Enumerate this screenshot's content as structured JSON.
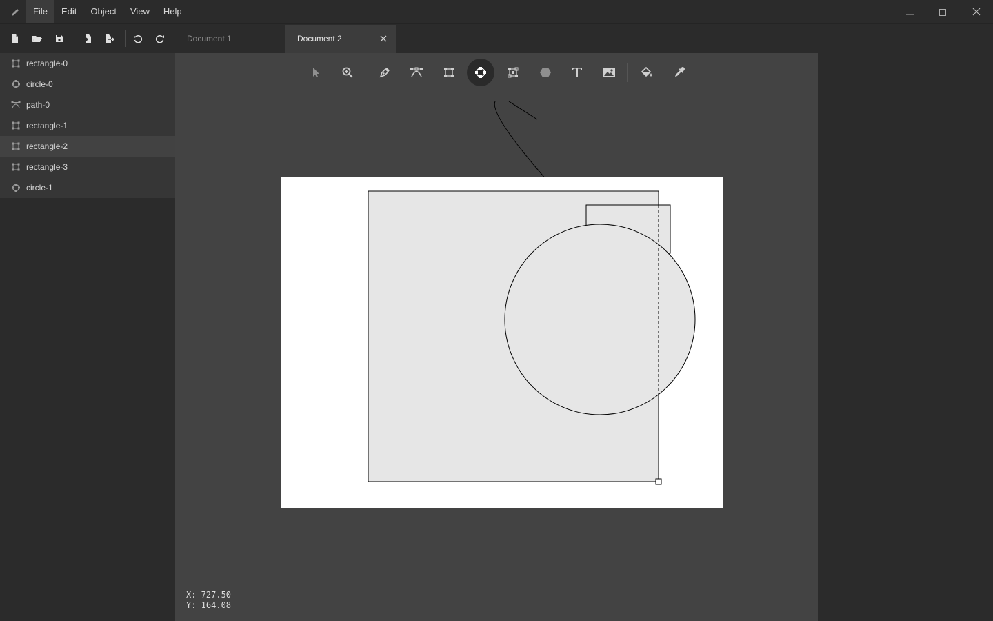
{
  "menu": {
    "items": [
      {
        "label": "File",
        "active": true
      },
      {
        "label": "Edit"
      },
      {
        "label": "Object"
      },
      {
        "label": "View"
      },
      {
        "label": "Help"
      }
    ]
  },
  "window_controls": [
    "minimize-icon",
    "restore-icon",
    "close-icon"
  ],
  "toolbar": {
    "buttons": [
      "new-file-icon",
      "open-folder-icon",
      "save-icon",
      "import-icon",
      "export-icon",
      "undo-icon",
      "redo-icon"
    ]
  },
  "tabs": [
    {
      "label": "Document 1",
      "active": false
    },
    {
      "label": "Document 2",
      "active": true
    }
  ],
  "layers": [
    {
      "label": "rectangle-0",
      "icon": "rectangle-icon"
    },
    {
      "label": "circle-0",
      "icon": "circle-icon"
    },
    {
      "label": "path-0",
      "icon": "path-icon"
    },
    {
      "label": "rectangle-1",
      "icon": "rectangle-icon"
    },
    {
      "label": "rectangle-2",
      "icon": "rectangle-icon",
      "selected": true
    },
    {
      "label": "rectangle-3",
      "icon": "rectangle-icon"
    },
    {
      "label": "circle-1",
      "icon": "circle-icon"
    }
  ],
  "tools": [
    {
      "name": "select-tool",
      "icon": "cursor-icon"
    },
    {
      "name": "zoom-tool",
      "icon": "zoom-in-icon"
    },
    {
      "name": "pen-tool",
      "icon": "pen-nib-icon"
    },
    {
      "name": "path-tool",
      "icon": "bezier-icon"
    },
    {
      "name": "rectangle-tool",
      "icon": "rectangle-icon"
    },
    {
      "name": "circle-tool",
      "icon": "circle-icon",
      "active": true
    },
    {
      "name": "transform-tool",
      "icon": "transform-icon"
    },
    {
      "name": "polygon-tool",
      "icon": "hexagon-icon"
    },
    {
      "name": "text-tool",
      "icon": "text-icon"
    },
    {
      "name": "image-tool",
      "icon": "image-icon"
    },
    {
      "name": "fill-tool",
      "icon": "paint-bucket-icon"
    },
    {
      "name": "eyedropper-tool",
      "icon": "eyedropper-icon"
    }
  ],
  "status": {
    "x": "X: 727.50",
    "y": "Y: 164.08"
  },
  "colors": {
    "canvas": "#ffffff",
    "shape_fill": "#e6e6e6",
    "workspace": "#434343",
    "panel": "#2b2b2b"
  }
}
